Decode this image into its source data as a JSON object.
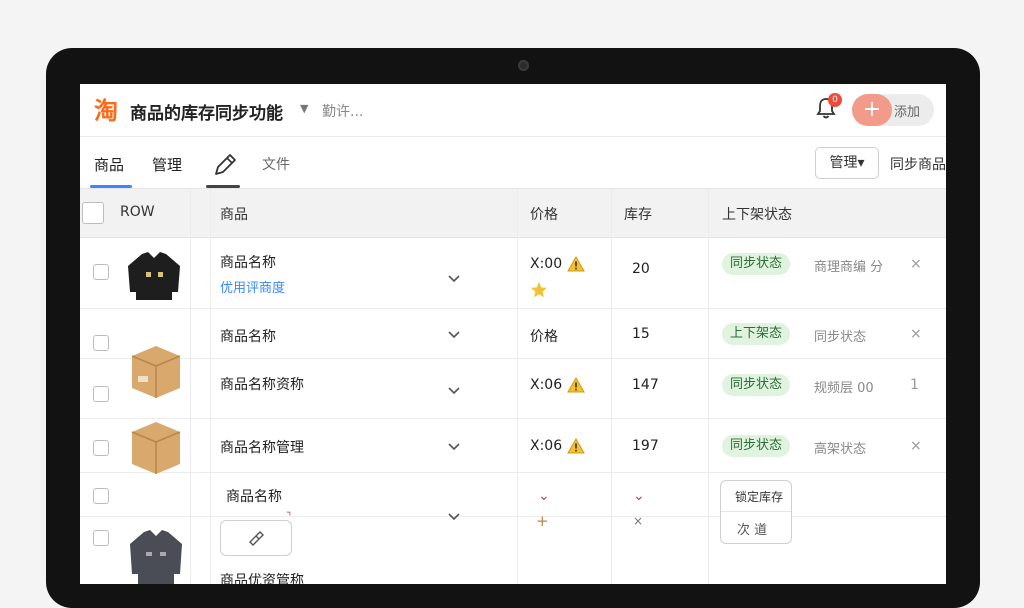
{
  "header": {
    "logo": "淘",
    "title": "商品的库存同步功能",
    "extra": "勤许...",
    "notification_count": "0",
    "action_label": "添加"
  },
  "tabs": [
    {
      "label": "商品"
    },
    {
      "label": "管理"
    },
    {
      "label": "文件"
    }
  ],
  "toolbar": {
    "manage_label": "管理▾",
    "sync_label": "同步商品"
  },
  "table": {
    "headers": {
      "id": "ROW",
      "product": "商品",
      "price": "价格",
      "stock": "库存",
      "status": "上下架状态"
    },
    "rows": [
      {
        "name": "商品名称",
        "sublink": "优用评商度",
        "price": "X:00",
        "stock": "20",
        "status": "同步状态",
        "op": "商理商编 分",
        "action": "×"
      },
      {
        "name": "商品名称",
        "price": "价格",
        "stock": "15",
        "status": "上下架态",
        "op": "同步状态",
        "action": "×"
      },
      {
        "name": "商品名称资称",
        "price": "X:06",
        "stock": "147",
        "status": "同步状态",
        "op": "规频层 00",
        "action": "1"
      },
      {
        "name": "商品名称管理",
        "price": "X:06",
        "stock": "197",
        "status": "同步状态",
        "op": "高架状态",
        "action": "×"
      },
      {
        "name": "商品名称",
        "price": "",
        "stock": "",
        "status": "",
        "op": "",
        "action": ""
      },
      {
        "name": "商品优资管称",
        "price": "",
        "stock": "",
        "status": "",
        "op": "",
        "action": ""
      }
    ],
    "popup": {
      "option_a": "锁定库存",
      "option_b": "次 道"
    }
  },
  "colors": {
    "accent": "#3a86ff",
    "brand": "#ff6a1a",
    "status_bg": "#dff3df",
    "status_text": "#2c6b35",
    "badge_red": "#f04a3a"
  }
}
